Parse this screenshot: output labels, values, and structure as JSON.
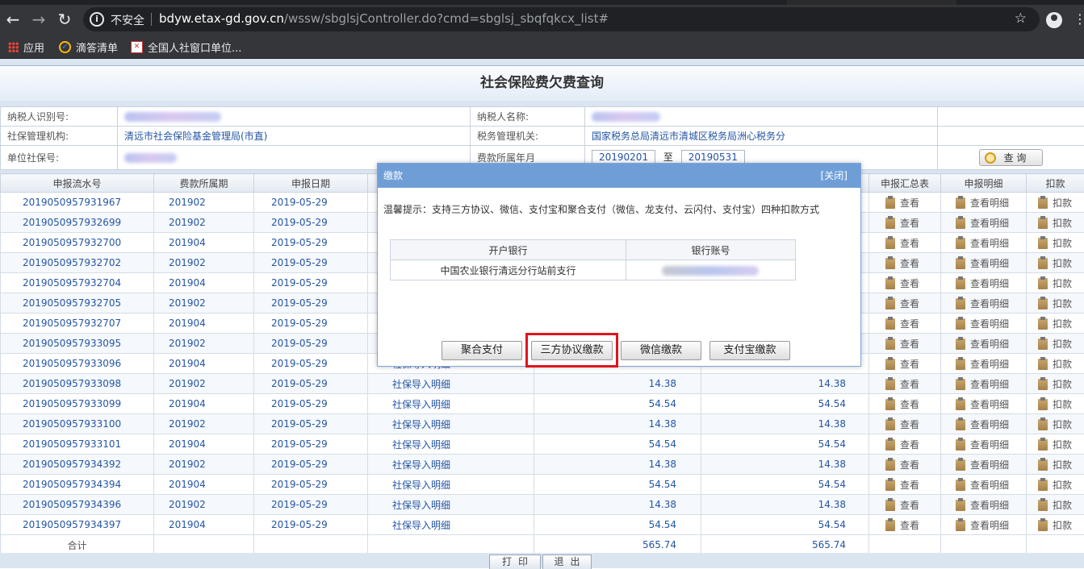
{
  "browser": {
    "security_label": "不安全",
    "url_host": "bdyw.etax-gd.gov.cn",
    "url_path": "/wssw/sbglsjController.do?cmd=sbglsj_sbqfqkcx_list#",
    "bookmarks": [
      {
        "label": "应用",
        "icon": "apps-grid-icon"
      },
      {
        "label": "滴答清单",
        "icon": "ticktick-icon"
      },
      {
        "label": "全国人社窗口单位...",
        "icon": "social-security-icon"
      }
    ]
  },
  "page": {
    "title": "社会保险费欠费查询",
    "info": {
      "taxpayer_id_label": "纳税人识别号:",
      "taxpayer_name_label": "纳税人名称:",
      "si_agency_label": "社保管理机构:",
      "si_agency_value": "清远市社会保险基金管理局(市直)",
      "tax_agency_label": "税务管理机关:",
      "tax_agency_value": "国家税务总局清远市清城区税务局洲心税务分",
      "unit_si_no_label": "单位社保号:",
      "fee_period_label": "费款所属年月",
      "period_from": "20190201",
      "period_to_word": "至",
      "period_to": "20190531",
      "query_button": "查 询"
    },
    "table": {
      "headers": [
        "申报流水号",
        "费款所属期",
        "申报日期",
        "",
        "",
        "",
        "申报汇总表",
        "申报明细",
        "扣款"
      ],
      "rows": [
        {
          "serial": "2019050957931967",
          "period": "201902",
          "date": "2019-05-29",
          "type": "",
          "amount1": "",
          "amount2": ""
        },
        {
          "serial": "2019050957932699",
          "period": "201902",
          "date": "2019-05-29",
          "type": "",
          "amount1": "",
          "amount2": ""
        },
        {
          "serial": "2019050957932700",
          "period": "201904",
          "date": "2019-05-29",
          "type": "",
          "amount1": "",
          "amount2": ""
        },
        {
          "serial": "2019050957932702",
          "period": "201902",
          "date": "2019-05-29",
          "type": "",
          "amount1": "",
          "amount2": ""
        },
        {
          "serial": "2019050957932704",
          "period": "201904",
          "date": "2019-05-29",
          "type": "",
          "amount1": "",
          "amount2": ""
        },
        {
          "serial": "2019050957932705",
          "period": "201902",
          "date": "2019-05-29",
          "type": "",
          "amount1": "",
          "amount2": ""
        },
        {
          "serial": "2019050957932707",
          "period": "201904",
          "date": "2019-05-29",
          "type": "",
          "amount1": "",
          "amount2": ""
        },
        {
          "serial": "2019050957933095",
          "period": "201902",
          "date": "2019-05-29",
          "type": "",
          "amount1": "",
          "amount2": ""
        },
        {
          "serial": "2019050957933096",
          "period": "201904",
          "date": "2019-05-29",
          "type": "社保导入明细",
          "amount1": "",
          "amount2": ""
        },
        {
          "serial": "2019050957933098",
          "period": "201902",
          "date": "2019-05-29",
          "type": "社保导入明细",
          "amount1": "14.38",
          "amount2": "14.38"
        },
        {
          "serial": "2019050957933099",
          "period": "201904",
          "date": "2019-05-29",
          "type": "社保导入明细",
          "amount1": "54.54",
          "amount2": "54.54"
        },
        {
          "serial": "2019050957933100",
          "period": "201902",
          "date": "2019-05-29",
          "type": "社保导入明细",
          "amount1": "14.38",
          "amount2": "14.38"
        },
        {
          "serial": "2019050957933101",
          "period": "201904",
          "date": "2019-05-29",
          "type": "社保导入明细",
          "amount1": "54.54",
          "amount2": "54.54"
        },
        {
          "serial": "2019050957934392",
          "period": "201902",
          "date": "2019-05-29",
          "type": "社保导入明细",
          "amount1": "14.38",
          "amount2": "14.38"
        },
        {
          "serial": "2019050957934394",
          "period": "201904",
          "date": "2019-05-29",
          "type": "社保导入明细",
          "amount1": "54.54",
          "amount2": "54.54"
        },
        {
          "serial": "2019050957934396",
          "period": "201902",
          "date": "2019-05-29",
          "type": "社保导入明细",
          "amount1": "14.38",
          "amount2": "14.38"
        },
        {
          "serial": "2019050957934397",
          "period": "201904",
          "date": "2019-05-29",
          "type": "社保导入明细",
          "amount1": "54.54",
          "amount2": "54.54"
        }
      ],
      "action_view": "查看",
      "action_view_detail": "查看明细",
      "action_deduct": "扣款",
      "total_label": "合计",
      "total1": "565.74",
      "total2": "565.74"
    },
    "footer": {
      "print_button": "打印",
      "exit_button": "退出"
    }
  },
  "modal": {
    "title": "缴款",
    "close_label": "[关闭]",
    "tip": "温馨提示：支持三方协议、微信、支付宝和聚合支付（微信、龙支付、云闪付、支付宝）四种扣款方式",
    "bank_header": "开户银行",
    "account_header": "银行账号",
    "bank_value": "中国农业银行清远分行站前支行",
    "buttons": {
      "aggregate": "聚合支付",
      "tripartite": "三方协议缴款",
      "wechat": "微信缴款",
      "alipay": "支付宝缴款"
    },
    "highlight_color": "#e0141e"
  }
}
